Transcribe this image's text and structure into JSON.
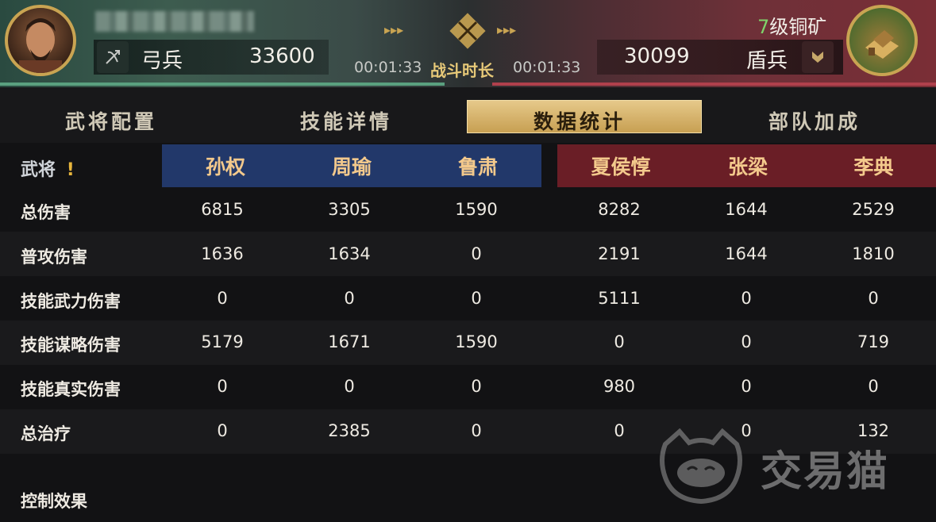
{
  "header": {
    "left": {
      "troop_type": "弓兵",
      "troop_count": "33600"
    },
    "right": {
      "troop_type": "盾兵",
      "troop_count": "30099",
      "city_level_num": "7",
      "city_level_text": "级铜矿"
    },
    "time_left": "00:01:33",
    "time_right": "00:01:33",
    "battle_label": "战斗时长"
  },
  "tabs": [
    {
      "label": "武将配置"
    },
    {
      "label": "技能详情"
    },
    {
      "label": "数据统计",
      "active": true
    },
    {
      "label": "部队加成"
    }
  ],
  "table": {
    "corner_label": "武将",
    "corner_mark": "!",
    "generals": [
      "孙权",
      "周瑜",
      "鲁肃",
      "夏侯惇",
      "张梁",
      "李典"
    ],
    "rows": [
      {
        "label": "总伤害",
        "values": [
          "6815",
          "3305",
          "1590",
          "8282",
          "1644",
          "2529"
        ]
      },
      {
        "label": "普攻伤害",
        "values": [
          "1636",
          "1634",
          "0",
          "2191",
          "1644",
          "1810"
        ]
      },
      {
        "label": "技能武力伤害",
        "values": [
          "0",
          "0",
          "0",
          "5111",
          "0",
          "0"
        ]
      },
      {
        "label": "技能谋略伤害",
        "values": [
          "5179",
          "1671",
          "1590",
          "0",
          "0",
          "719"
        ]
      },
      {
        "label": "技能真实伤害",
        "values": [
          "0",
          "0",
          "0",
          "980",
          "0",
          "0"
        ]
      },
      {
        "label": "总治疗",
        "values": [
          "0",
          "2385",
          "0",
          "0",
          "0",
          "132"
        ]
      }
    ],
    "section_label": "控制效果"
  },
  "watermark": {
    "text": "交易猫"
  },
  "colors": {
    "gold": "#c9a452",
    "blue_team": "#22386a",
    "red_team": "#6a1e26",
    "green_level": "#7fd36a"
  }
}
